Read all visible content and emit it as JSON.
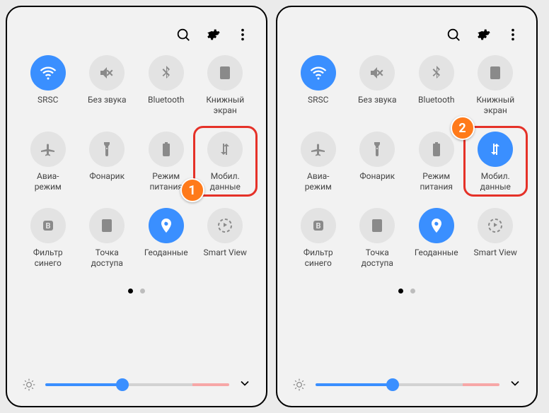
{
  "phones": [
    {
      "tiles": [
        {
          "id": "wifi",
          "label": "SRSC",
          "icon": "wifi-icon",
          "active": true
        },
        {
          "id": "mute",
          "label": "Без звука",
          "icon": "mute-icon",
          "active": false
        },
        {
          "id": "bluetooth",
          "label": "Bluetooth",
          "icon": "bluetooth-icon",
          "active": false
        },
        {
          "id": "book",
          "label": "Книжный\nэкран",
          "icon": "portrait-icon",
          "active": false
        },
        {
          "id": "airplane",
          "label": "Авиа-\nрежим",
          "icon": "airplane-icon",
          "active": false
        },
        {
          "id": "flashlight",
          "label": "Фонарик",
          "icon": "flashlight-icon",
          "active": false
        },
        {
          "id": "power",
          "label": "Режим\nпитания",
          "icon": "battery-icon",
          "active": false
        },
        {
          "id": "mobiledata",
          "label": "Мобил.\nданные",
          "icon": "data-icon",
          "active": false
        },
        {
          "id": "bluelight",
          "label": "Фильтр\nсинего",
          "icon": "filter-b-icon",
          "active": false
        },
        {
          "id": "hotspot",
          "label": "Точка\nдоступа",
          "icon": "hotspot-icon",
          "active": false
        },
        {
          "id": "location",
          "label": "Геоданные",
          "icon": "location-icon",
          "active": true
        },
        {
          "id": "smartview",
          "label": "Smart View",
          "icon": "smartview-icon",
          "active": false
        }
      ],
      "highlight_index": 7,
      "badge": "1",
      "badge_pos": "bottom"
    },
    {
      "tiles": [
        {
          "id": "wifi",
          "label": "SRSC",
          "icon": "wifi-icon",
          "active": true
        },
        {
          "id": "mute",
          "label": "Без звука",
          "icon": "mute-icon",
          "active": false
        },
        {
          "id": "bluetooth",
          "label": "Bluetooth",
          "icon": "bluetooth-icon",
          "active": false
        },
        {
          "id": "book",
          "label": "Книжный\nэкран",
          "icon": "portrait-icon",
          "active": false
        },
        {
          "id": "airplane",
          "label": "Авиа-\nрежим",
          "icon": "airplane-icon",
          "active": false
        },
        {
          "id": "flashlight",
          "label": "Фонарик",
          "icon": "flashlight-icon",
          "active": false
        },
        {
          "id": "power",
          "label": "Режим\nпитания",
          "icon": "battery-icon",
          "active": false
        },
        {
          "id": "mobiledata",
          "label": "Мобил.\nданные",
          "icon": "data-icon",
          "active": true
        },
        {
          "id": "bluelight",
          "label": "Фильтр\nсинего",
          "icon": "filter-b-icon",
          "active": false
        },
        {
          "id": "hotspot",
          "label": "Точка\nдоступа",
          "icon": "hotspot-icon",
          "active": false
        },
        {
          "id": "location",
          "label": "Геоданные",
          "icon": "location-icon",
          "active": true
        },
        {
          "id": "smartview",
          "label": "Smart View",
          "icon": "smartview-icon",
          "active": false
        }
      ],
      "highlight_index": 7,
      "badge": "2",
      "badge_pos": "top"
    }
  ],
  "colors": {
    "active": "#3a8fff",
    "inactive": "#e3e3e3",
    "badge": "#ff7a1a",
    "highlight": "#e53128"
  }
}
